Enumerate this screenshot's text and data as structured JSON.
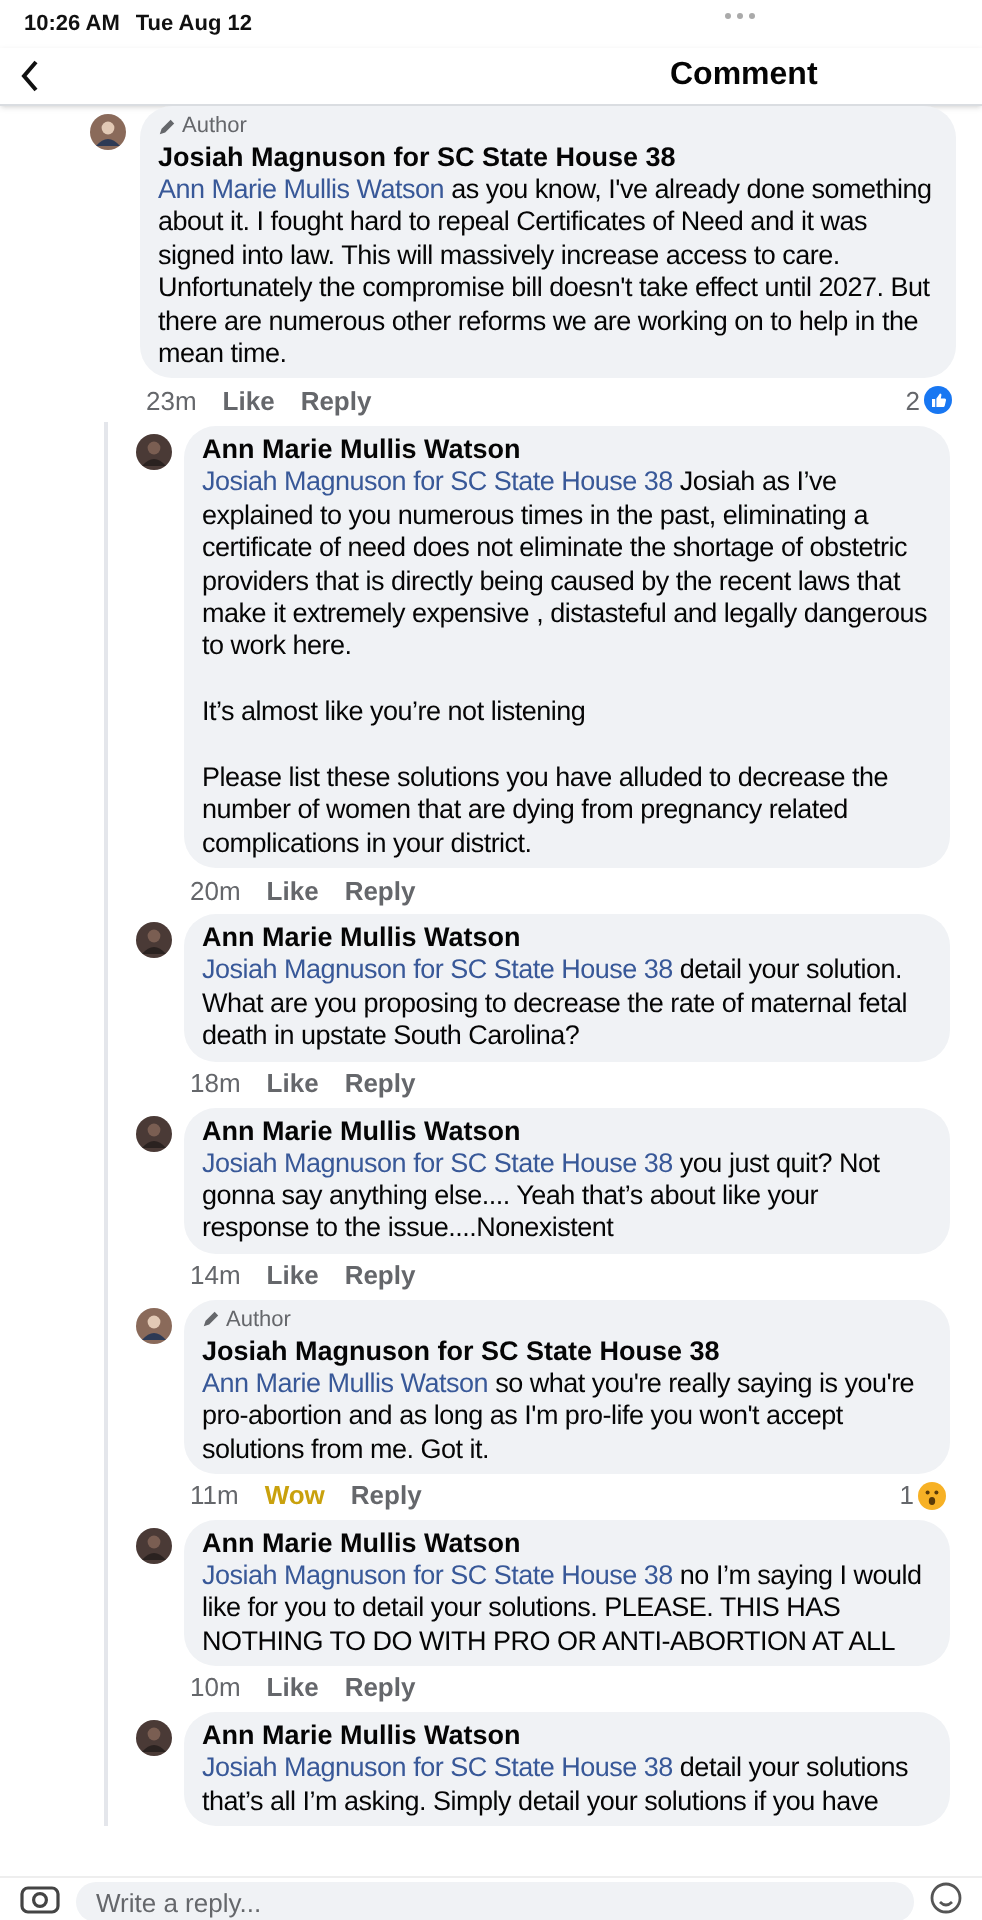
{
  "status_bar": {
    "time": "10:26 AM",
    "date": "Tue Aug 12"
  },
  "header": {
    "title": "Comment"
  },
  "comments": [
    {
      "kind": "top",
      "author_badge": "Author",
      "name": "Josiah Magnuson for SC State House 38",
      "mention": "Ann Marie Mullis Watson",
      "paragraphs": [
        "as you know, I've already done something about it. I fought hard to repeal Certificates of Need and it was signed into law. This will massively increase access to care. Unfortunately the compromise bill doesn't take effect until 2027. But there are numerous other reforms we are working on to help in the mean time."
      ],
      "time": "23m",
      "like": {
        "label": "Like",
        "selected": false
      },
      "reply": "Reply",
      "reactions": {
        "count": "2",
        "kind": "like"
      }
    },
    {
      "kind": "reply",
      "name": "Ann Marie Mullis Watson",
      "mention": "Josiah Magnuson for SC State House 38",
      "paragraphs": [
        "Josiah as I’ve explained to you numerous times in the past,  eliminating a certificate of need does not eliminate the shortage of obstetric providers that is directly being caused by the recent laws that make it extremely expensive , distasteful and legally dangerous to work here.",
        "It’s almost like you’re not listening",
        "Please list these solutions you have alluded to decrease the number of women that are dying from pregnancy related complications in your district."
      ],
      "time": "20m",
      "like": {
        "label": "Like",
        "selected": false
      },
      "reply": "Reply"
    },
    {
      "kind": "reply",
      "name": "Ann Marie Mullis Watson",
      "mention": "Josiah Magnuson for SC State House 38",
      "paragraphs": [
        "detail your solution. What are you proposing to decrease the rate of maternal fetal death in upstate South Carolina?"
      ],
      "time": "18m",
      "like": {
        "label": "Like",
        "selected": false
      },
      "reply": "Reply"
    },
    {
      "kind": "reply",
      "name": "Ann Marie Mullis Watson",
      "mention": "Josiah Magnuson for SC State House 38",
      "paragraphs": [
        "you just quit? Not gonna say anything else.... Yeah that’s about like your response to the issue....Nonexistent"
      ],
      "time": "14m",
      "like": {
        "label": "Like",
        "selected": false
      },
      "reply": "Reply"
    },
    {
      "kind": "reply",
      "author_badge": "Author",
      "name": "Josiah Magnuson for SC State House 38",
      "mention": "Ann Marie Mullis Watson",
      "paragraphs": [
        "so what you're really saying is you're pro-abortion and as long as I'm pro-life you won't accept solutions from me. Got it."
      ],
      "time": "11m",
      "like": {
        "label": "Wow",
        "selected": true
      },
      "reply": "Reply",
      "reactions": {
        "count": "1",
        "kind": "wow"
      }
    },
    {
      "kind": "reply",
      "name": "Ann Marie Mullis Watson",
      "mention": "Josiah Magnuson for SC State House 38",
      "paragraphs": [
        "no I’m saying I would like for you to detail your solutions. PLEASE. THIS HAS NOTHING TO DO WITH PRO OR ANTI-ABORTION AT ALL"
      ],
      "time": "10m",
      "like": {
        "label": "Like",
        "selected": false
      },
      "reply": "Reply"
    },
    {
      "kind": "reply",
      "name": "Ann Marie Mullis Watson",
      "mention": "Josiah Magnuson for SC State House 38",
      "paragraphs": [
        "detail your solutions that’s all I’m asking. Simply detail your solutions if you have"
      ]
    }
  ],
  "composer": {
    "placeholder": "Write a reply..."
  }
}
